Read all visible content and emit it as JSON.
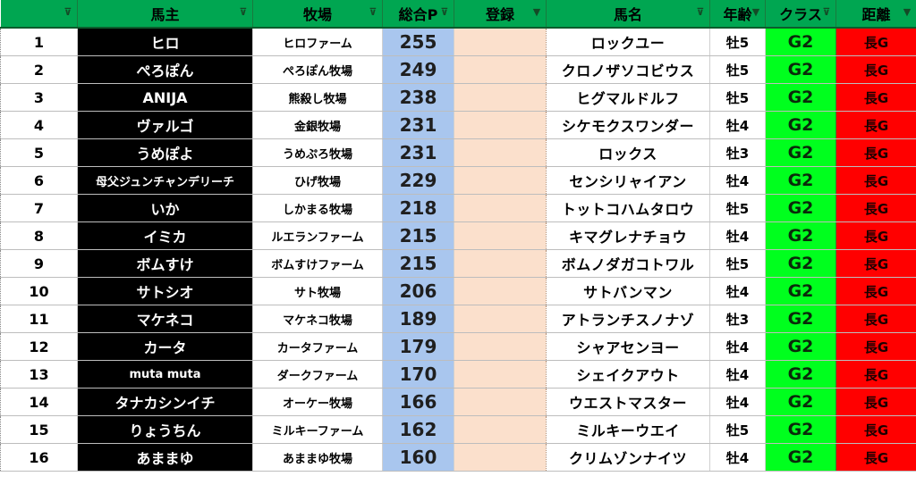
{
  "columns": [
    {
      "key": "rank",
      "label": "",
      "filter": "sort-filter-icon"
    },
    {
      "key": "owner",
      "label": "馬主",
      "filter": "sort-filter-icon"
    },
    {
      "key": "farm",
      "label": "牧場",
      "filter": "sort-filter-icon"
    },
    {
      "key": "points",
      "label": "総合P",
      "filter": "sort-filter-icon"
    },
    {
      "key": "registration",
      "label": "登録",
      "filter": "filter-active-icon"
    },
    {
      "key": "horse",
      "label": "馬名",
      "filter": "sort-filter-icon"
    },
    {
      "key": "age",
      "label": "年齢",
      "filter": "filter-active-icon"
    },
    {
      "key": "class",
      "label": "クラス",
      "filter": "sort-filter-icon"
    },
    {
      "key": "distance",
      "label": "距離",
      "filter": "filter-active-icon"
    }
  ],
  "rows": [
    {
      "rank": "1",
      "owner": "ヒロ",
      "farm": "ヒロファーム",
      "points": "255",
      "registration": "",
      "horse": "ロックユー",
      "age": "牡5",
      "class": "G2",
      "distance": "長G"
    },
    {
      "rank": "2",
      "owner": "ぺろぽん",
      "farm": "ぺろぽん牧場",
      "points": "249",
      "registration": "",
      "horse": "クロノザソコビウス",
      "age": "牡5",
      "class": "G2",
      "distance": "長G"
    },
    {
      "rank": "3",
      "owner": "ANIJA",
      "farm": "熊殺し牧場",
      "points": "238",
      "registration": "",
      "horse": "ヒグマルドルフ",
      "age": "牡5",
      "class": "G2",
      "distance": "長G"
    },
    {
      "rank": "4",
      "owner": "ヴァルゴ",
      "farm": "金銀牧場",
      "points": "231",
      "registration": "",
      "horse": "シケモクスワンダー",
      "age": "牡4",
      "class": "G2",
      "distance": "長G"
    },
    {
      "rank": "5",
      "owner": "うめぽよ",
      "farm": "うめぷろ牧場",
      "points": "231",
      "registration": "",
      "horse": "ロックス",
      "age": "牡3",
      "class": "G2",
      "distance": "長G"
    },
    {
      "rank": "6",
      "owner": "母父ジュンチャンデリーチ",
      "farm": "ひげ牧場",
      "points": "229",
      "registration": "",
      "horse": "センシリャイアン",
      "age": "牡4",
      "class": "G2",
      "distance": "長G"
    },
    {
      "rank": "7",
      "owner": "いか",
      "farm": "しかまる牧場",
      "points": "218",
      "registration": "",
      "horse": "トットコハムタロウ",
      "age": "牡5",
      "class": "G2",
      "distance": "長G"
    },
    {
      "rank": "8",
      "owner": "イミカ",
      "farm": "ルエランファーム",
      "points": "215",
      "registration": "",
      "horse": "キマグレナチョウ",
      "age": "牡4",
      "class": "G2",
      "distance": "長G"
    },
    {
      "rank": "9",
      "owner": "ボムすけ",
      "farm": "ボムすけファーム",
      "points": "215",
      "registration": "",
      "horse": "ボムノダガコトワル",
      "age": "牡5",
      "class": "G2",
      "distance": "長G"
    },
    {
      "rank": "10",
      "owner": "サトシオ",
      "farm": "サト牧場",
      "points": "206",
      "registration": "",
      "horse": "サトバンマン",
      "age": "牡4",
      "class": "G2",
      "distance": "長G"
    },
    {
      "rank": "11",
      "owner": "マケネコ",
      "farm": "マケネコ牧場",
      "points": "189",
      "registration": "",
      "horse": "アトランチスノナゾ",
      "age": "牡3",
      "class": "G2",
      "distance": "長G"
    },
    {
      "rank": "12",
      "owner": "カータ",
      "farm": "カータファーム",
      "points": "179",
      "registration": "",
      "horse": "シャアセンヨー",
      "age": "牡4",
      "class": "G2",
      "distance": "長G"
    },
    {
      "rank": "13",
      "owner": "muta muta",
      "farm": "ダークファーム",
      "points": "170",
      "registration": "",
      "horse": "シェイクアウト",
      "age": "牡4",
      "class": "G2",
      "distance": "長G"
    },
    {
      "rank": "14",
      "owner": "タナカシンイチ",
      "farm": "オーケー牧場",
      "points": "166",
      "registration": "",
      "horse": "ウエストマスター",
      "age": "牡4",
      "class": "G2",
      "distance": "長G"
    },
    {
      "rank": "15",
      "owner": "りょうちん",
      "farm": "ミルキーファーム",
      "points": "162",
      "registration": "",
      "horse": "ミルキーウエイ",
      "age": "牡5",
      "class": "G2",
      "distance": "長G"
    },
    {
      "rank": "16",
      "owner": "あままゆ",
      "farm": "あままゆ牧場",
      "points": "160",
      "registration": "",
      "horse": "クリムゾンナイツ",
      "age": "牡4",
      "class": "G2",
      "distance": "長G"
    }
  ]
}
